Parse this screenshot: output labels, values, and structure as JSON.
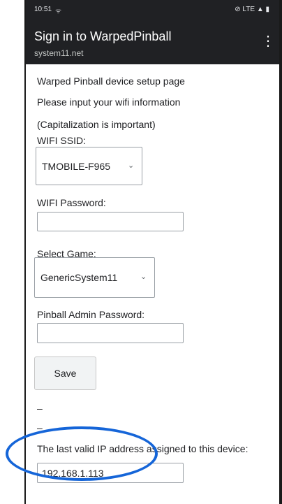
{
  "status_bar": {
    "time": "10:51",
    "signal_text": "ᯤ",
    "right_text": "LTE"
  },
  "app_bar": {
    "title": "Sign in to WarpedPinball",
    "subtitle": "system11.net",
    "menu_icon": "⋮"
  },
  "page": {
    "heading": "Warped Pinball device setup page",
    "instruction": "Please input your wifi information",
    "note": "(Capitalization is important)",
    "wifi_ssid": {
      "label": "WIFI SSID:",
      "selected": "TMOBILE-F965"
    },
    "wifi_password": {
      "label": "WIFI Password:",
      "value": ""
    },
    "select_game": {
      "label": "Select Game:",
      "selected": "GenericSystem11"
    },
    "admin_password": {
      "label": "Pinball Admin Password:",
      "value": ""
    },
    "save_label": "Save",
    "dash1": "–",
    "dash2": "–",
    "ip_info": {
      "label": "The last valid IP address assigned to this device:",
      "value": "192.168.1.113"
    }
  },
  "colors": {
    "app_bar_bg": "#202124",
    "highlight": "#1565d8"
  }
}
